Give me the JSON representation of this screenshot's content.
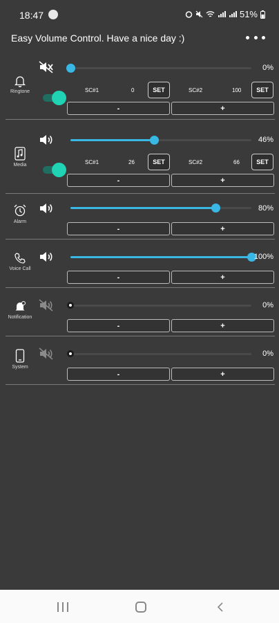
{
  "status_bar": {
    "time": "18:47",
    "battery": "51%"
  },
  "app": {
    "title": "Easy Volume Control. Have a nice day :)"
  },
  "colors": {
    "accent": "#39b8e6",
    "toggle_on": "#1fd3b4",
    "background": "#3a3a3a"
  },
  "streams": [
    {
      "key": "ringtone",
      "label": "Ringtone",
      "icon": "bell-icon",
      "volume_icon": "muted-icon",
      "percent_text": "0%",
      "percent": 0,
      "toggle_on": true,
      "sc1_label": "SC#1",
      "sc1_value": "0",
      "sc2_label": "SC#2",
      "sc2_value": "100",
      "set_label": "SET",
      "minus_label": "-",
      "plus_label": "+"
    },
    {
      "key": "media",
      "label": "Media",
      "icon": "music-note-icon",
      "volume_icon": "volume-icon",
      "percent_text": "46%",
      "percent": 46,
      "toggle_on": true,
      "sc1_label": "SC#1",
      "sc1_value": "26",
      "sc2_label": "SC#2",
      "sc2_value": "66",
      "set_label": "SET",
      "minus_label": "-",
      "plus_label": "+"
    },
    {
      "key": "alarm",
      "label": "Alarm",
      "icon": "alarm-clock-icon",
      "volume_icon": "volume-icon",
      "percent_text": "80%",
      "percent": 80,
      "minus_label": "-",
      "plus_label": "+"
    },
    {
      "key": "voice_call",
      "label": "Voice Call",
      "icon": "phone-icon",
      "volume_icon": "volume-icon",
      "percent_text": "100%",
      "percent": 100,
      "minus_label": "-",
      "plus_label": "+"
    },
    {
      "key": "notification",
      "label": "Notification",
      "icon": "notification-bell-icon",
      "volume_icon": "muted-volume-icon",
      "percent_text": "0%",
      "percent": 0,
      "minus_label": "-",
      "plus_label": "+"
    },
    {
      "key": "system",
      "label": "System",
      "icon": "phone-device-icon",
      "volume_icon": "muted-volume-icon",
      "percent_text": "0%",
      "percent": 0,
      "minus_label": "-",
      "plus_label": "+"
    }
  ]
}
